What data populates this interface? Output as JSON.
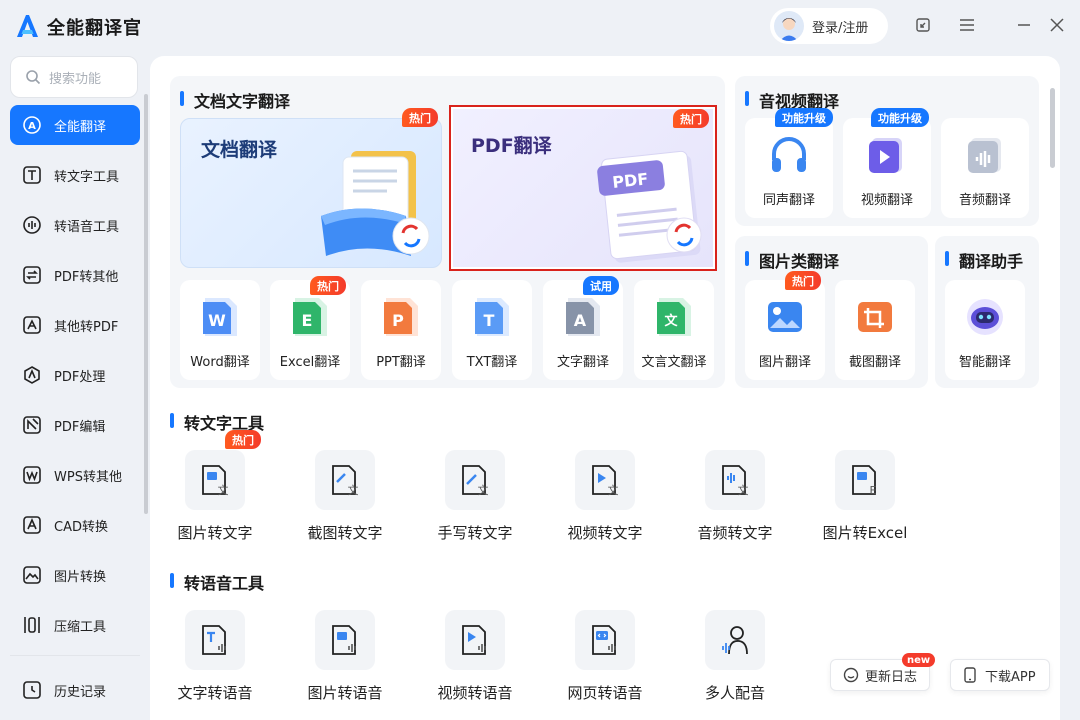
{
  "app": {
    "title": "全能翻译官"
  },
  "header": {
    "login_label": "登录/注册"
  },
  "sidebar": {
    "search_placeholder": "搜索功能",
    "items": [
      {
        "label": "全能翻译",
        "icon": "translate-icon",
        "active": true
      },
      {
        "label": "转文字工具",
        "icon": "text-t-icon"
      },
      {
        "label": "转语音工具",
        "icon": "voice-wave-icon"
      },
      {
        "label": "PDF转其他",
        "icon": "pdf-convert-icon"
      },
      {
        "label": "其他转PDF",
        "icon": "to-pdf-icon"
      },
      {
        "label": "PDF处理",
        "icon": "pdf-process-icon"
      },
      {
        "label": "PDF编辑",
        "icon": "pdf-edit-icon"
      },
      {
        "label": "WPS转其他",
        "icon": "wps-icon"
      },
      {
        "label": "CAD转换",
        "icon": "cad-icon"
      },
      {
        "label": "图片转换",
        "icon": "image-icon"
      },
      {
        "label": "压缩工具",
        "icon": "compress-icon"
      }
    ],
    "history_label": "历史记录"
  },
  "doc_section": {
    "title": "文档文字翻译",
    "cards": [
      {
        "label": "文档翻译",
        "badge": "热门"
      },
      {
        "label": "PDF翻译",
        "badge": "热门"
      }
    ],
    "tools": [
      {
        "label": "Word翻译",
        "glyph": "W",
        "color": "#2f6fe4"
      },
      {
        "label": "Excel翻译",
        "glyph": "E",
        "color": "#22a45d",
        "badge": "热门"
      },
      {
        "label": "PPT翻译",
        "glyph": "P",
        "color": "#f0692a"
      },
      {
        "label": "TXT翻译",
        "glyph": "T",
        "color": "#3a86f0"
      },
      {
        "label": "文字翻译",
        "glyph": "A",
        "color": "#6d7a94",
        "badge": "试用"
      },
      {
        "label": "文言文翻译",
        "glyph": "文",
        "color": "#22a45d"
      }
    ]
  },
  "av_section": {
    "title": "音视频翻译",
    "badge": "功能升级",
    "tools": [
      {
        "label": "同声翻译",
        "badge": "功能升级"
      },
      {
        "label": "视频翻译",
        "badge": "功能升级"
      },
      {
        "label": "音频翻译"
      }
    ]
  },
  "img_section": {
    "title": "图片类翻译",
    "tools": [
      {
        "label": "图片翻译",
        "badge": "热门"
      },
      {
        "label": "截图翻译"
      }
    ]
  },
  "assist_section": {
    "title": "翻译助手",
    "tools": [
      {
        "label": "智能翻译"
      }
    ]
  },
  "text_tools": {
    "title": "转文字工具",
    "items": [
      {
        "label": "图片转文字",
        "badge": "热门",
        "sub": "文"
      },
      {
        "label": "截图转文字",
        "sub": "文"
      },
      {
        "label": "手写转文字",
        "sub": "文"
      },
      {
        "label": "视频转文字",
        "sub": "文"
      },
      {
        "label": "音频转文字",
        "sub": "文"
      },
      {
        "label": "图片转Excel",
        "sub": "E"
      }
    ]
  },
  "voice_tools": {
    "title": "转语音工具",
    "items": [
      {
        "label": "文字转语音"
      },
      {
        "label": "图片转语音"
      },
      {
        "label": "视频转语音"
      },
      {
        "label": "网页转语音"
      },
      {
        "label": "多人配音"
      }
    ]
  },
  "footer": {
    "changelog": "更新日志",
    "changelog_badge": "new",
    "download": "下载APP"
  },
  "colors": {
    "accent": "#1677ff",
    "hot": "#f43b2b",
    "highlight_border": "#d9231c"
  }
}
